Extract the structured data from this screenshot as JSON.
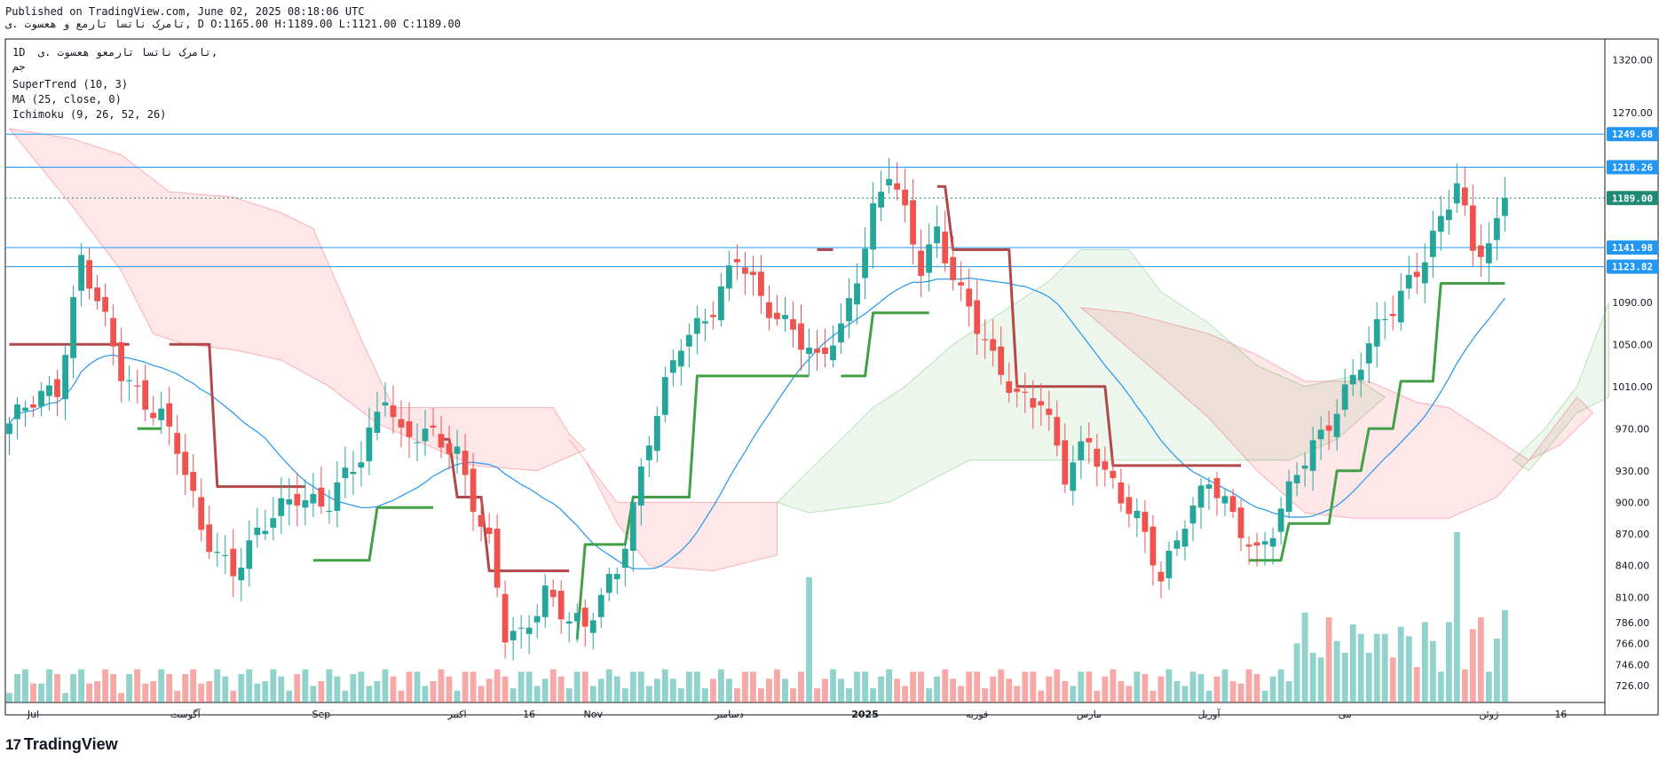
{
  "header": {
    "published": "Published on TradingView.com, June 02, 2025 08:18:06 UTC",
    "ohlc": "تامرک ناتسا تارمع و هعسوت .ی, D O:1165.00 H:1189.00 L:1121.00 C:1189.00"
  },
  "legend": {
    "symbol": "1D  تامرک ناتسا تارمعو هعسوت .ی,",
    "exchange": "جم",
    "supertrend": "SuperTrend (10, 3)",
    "ma": "MA (25, close, 0)",
    "ichimoku": "Ichimoku (9, 26, 52, 26)"
  },
  "brand": {
    "logo": "17",
    "name": "TradingView"
  },
  "colors": {
    "up": "#26a69a",
    "down": "#ef5350",
    "st_up": "#43a047",
    "st_down": "#b04a4a",
    "ma": "#2196f3",
    "hline": "#2196f3",
    "last_price": "#1e8a74"
  },
  "chart_data": {
    "type": "candlestick",
    "ylim": [
      710,
      1340
    ],
    "y_ticks": [
      1320,
      1270,
      1090,
      1050,
      1010,
      970,
      930,
      900,
      870,
      840,
      810,
      786,
      766,
      746,
      726
    ],
    "x_ticks": [
      {
        "label": "Jul",
        "i": 3
      },
      {
        "label": "آگوست",
        "i": 22
      },
      {
        "label": "Sep",
        "i": 39
      },
      {
        "label": "اکتبر",
        "i": 56
      },
      {
        "label": "16",
        "i": 65
      },
      {
        "label": "Nov",
        "i": 73
      },
      {
        "label": "دسامبر",
        "i": 90
      },
      {
        "label": "2025",
        "i": 107
      },
      {
        "label": "فوریه",
        "i": 121
      },
      {
        "label": "مارس",
        "i": 135
      },
      {
        "label": "آوریل",
        "i": 150
      },
      {
        "label": "می",
        "i": 167
      },
      {
        "label": "ژوئن",
        "i": 185
      },
      {
        "label": "16",
        "i": 194
      }
    ],
    "price_lines": [
      {
        "label": "1249.68",
        "value": 1249.68
      },
      {
        "label": "1218.26",
        "value": 1218.26
      },
      {
        "label": "1141.98",
        "value": 1141.98
      },
      {
        "label": "1123.82",
        "value": 1123.82
      }
    ],
    "last_price": {
      "label": "1189.00",
      "value": 1189.0
    },
    "candles": [],
    "supertrend": [],
    "ma": [],
    "volume": []
  }
}
